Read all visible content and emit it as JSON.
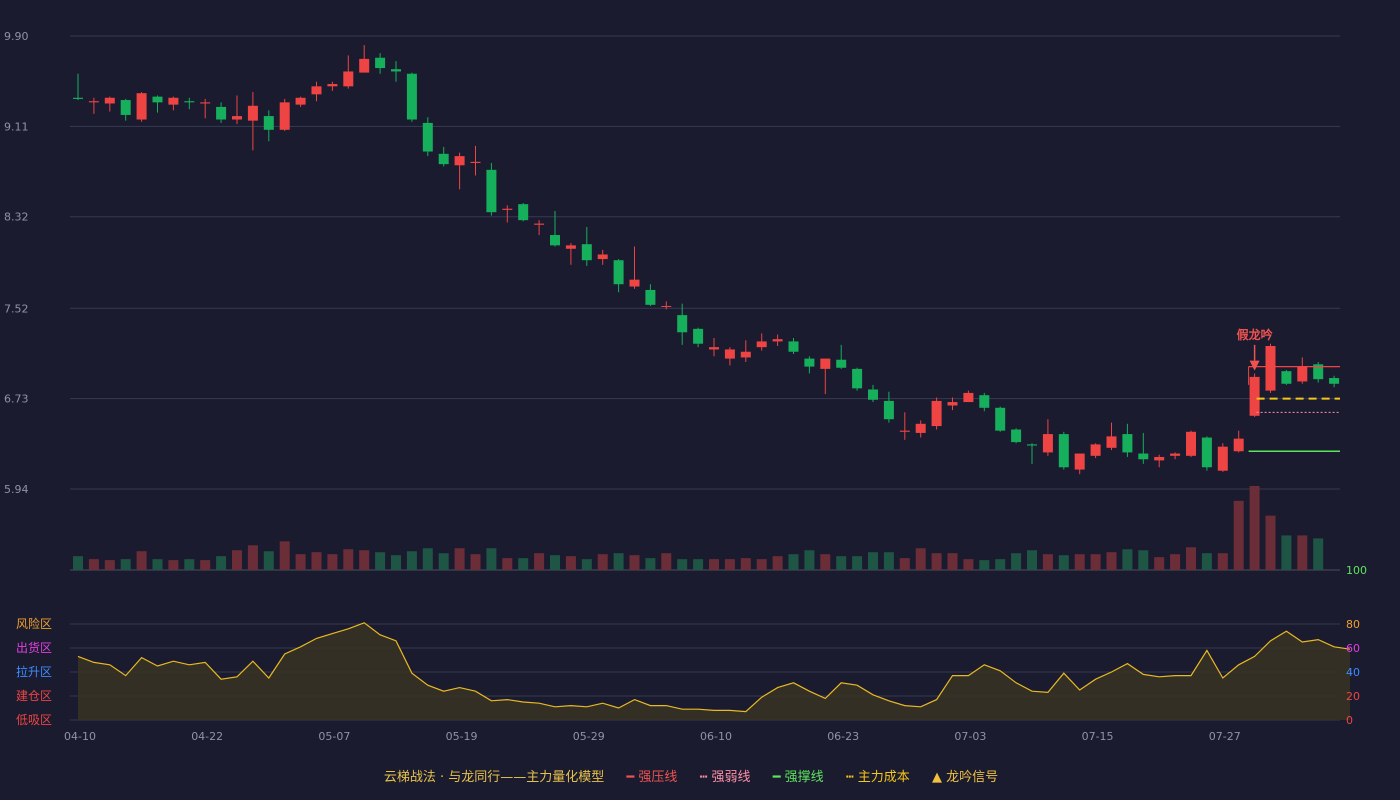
{
  "chart_data": [
    {
      "type": "candlestick",
      "title": "",
      "y_ticks": [
        "9.90",
        "9.11",
        "8.32",
        "7.52",
        "6.73",
        "5.94"
      ],
      "ylim": [
        5.94,
        9.9
      ],
      "x_ticks": [
        "04-10",
        "04-22",
        "05-07",
        "05-19",
        "05-29",
        "06-10",
        "06-23",
        "07-03",
        "07-15",
        "07-27"
      ],
      "x_tick_index": [
        0,
        8,
        16,
        24,
        32,
        40,
        48,
        56,
        64,
        72
      ],
      "candles": [
        [
          9.36,
          9.35,
          9.57,
          9.34
        ],
        [
          9.32,
          9.33,
          9.36,
          9.22
        ],
        [
          9.31,
          9.36,
          9.37,
          9.24
        ],
        [
          9.34,
          9.21,
          9.35,
          9.16
        ],
        [
          9.17,
          9.4,
          9.41,
          9.15
        ],
        [
          9.37,
          9.32,
          9.38,
          9.23
        ],
        [
          9.3,
          9.36,
          9.37,
          9.25
        ],
        [
          9.33,
          9.32,
          9.36,
          9.26
        ],
        [
          9.31,
          9.32,
          9.35,
          9.18
        ],
        [
          9.28,
          9.17,
          9.32,
          9.14
        ],
        [
          9.17,
          9.2,
          9.38,
          9.13
        ],
        [
          9.16,
          9.29,
          9.41,
          8.9
        ],
        [
          9.2,
          9.08,
          9.25,
          8.98
        ],
        [
          9.08,
          9.32,
          9.35,
          9.07
        ],
        [
          9.3,
          9.36,
          9.37,
          9.28
        ],
        [
          9.39,
          9.46,
          9.5,
          9.33
        ],
        [
          9.46,
          9.48,
          9.5,
          9.42
        ],
        [
          9.46,
          9.59,
          9.73,
          9.44
        ],
        [
          9.58,
          9.7,
          9.82,
          9.58
        ],
        [
          9.71,
          9.62,
          9.75,
          9.57
        ],
        [
          9.61,
          9.59,
          9.68,
          9.5
        ],
        [
          9.57,
          9.17,
          9.58,
          9.15
        ],
        [
          9.14,
          8.89,
          9.19,
          8.85
        ],
        [
          8.87,
          8.78,
          8.93,
          8.76
        ],
        [
          8.77,
          8.85,
          8.88,
          8.56
        ],
        [
          8.79,
          8.8,
          8.94,
          8.68
        ],
        [
          8.73,
          8.36,
          8.79,
          8.33
        ],
        [
          8.38,
          8.39,
          8.42,
          8.27
        ],
        [
          8.43,
          8.29,
          8.44,
          8.28
        ],
        [
          8.25,
          8.26,
          8.29,
          8.16
        ],
        [
          8.16,
          8.07,
          8.37,
          8.06
        ],
        [
          8.04,
          8.07,
          8.09,
          7.9
        ],
        [
          8.08,
          7.94,
          8.23,
          7.89
        ],
        [
          7.95,
          7.99,
          8.03,
          7.9
        ],
        [
          7.94,
          7.73,
          7.95,
          7.66
        ],
        [
          7.71,
          7.77,
          8.06,
          7.69
        ],
        [
          7.68,
          7.55,
          7.73,
          7.54
        ],
        [
          7.54,
          7.54,
          7.58,
          7.51
        ],
        [
          7.46,
          7.31,
          7.56,
          7.2
        ],
        [
          7.34,
          7.21,
          7.35,
          7.18
        ],
        [
          7.16,
          7.18,
          7.26,
          7.1
        ],
        [
          7.08,
          7.16,
          7.18,
          7.02
        ],
        [
          7.09,
          7.14,
          7.24,
          7.05
        ],
        [
          7.18,
          7.23,
          7.3,
          7.15
        ],
        [
          7.23,
          7.25,
          7.29,
          7.19
        ],
        [
          7.23,
          7.14,
          7.26,
          7.12
        ],
        [
          7.08,
          7.01,
          7.1,
          6.95
        ],
        [
          6.99,
          7.08,
          7.08,
          6.77
        ],
        [
          7.07,
          7.0,
          7.2,
          6.99
        ],
        [
          6.99,
          6.82,
          7.0,
          6.8
        ],
        [
          6.81,
          6.72,
          6.85,
          6.7
        ],
        [
          6.71,
          6.55,
          6.79,
          6.52
        ],
        [
          6.44,
          6.45,
          6.61,
          6.37
        ],
        [
          6.43,
          6.51,
          6.54,
          6.39
        ],
        [
          6.49,
          6.71,
          6.74,
          6.46
        ],
        [
          6.67,
          6.7,
          6.74,
          6.63
        ],
        [
          6.7,
          6.78,
          6.8,
          6.7
        ],
        [
          6.76,
          6.65,
          6.78,
          6.62
        ],
        [
          6.65,
          6.45,
          6.66,
          6.44
        ],
        [
          6.46,
          6.35,
          6.47,
          6.34
        ],
        [
          6.33,
          6.32,
          6.34,
          6.16
        ],
        [
          6.26,
          6.42,
          6.55,
          6.23
        ],
        [
          6.42,
          6.13,
          6.44,
          6.11
        ],
        [
          6.11,
          6.25,
          6.25,
          6.07
        ],
        [
          6.23,
          6.33,
          6.34,
          6.21
        ],
        [
          6.3,
          6.4,
          6.52,
          6.28
        ],
        [
          6.42,
          6.26,
          6.51,
          6.22
        ],
        [
          6.25,
          6.2,
          6.43,
          6.16
        ],
        [
          6.19,
          6.22,
          6.24,
          6.13
        ],
        [
          6.23,
          6.25,
          6.26,
          6.2
        ],
        [
          6.23,
          6.44,
          6.45,
          6.22
        ],
        [
          6.39,
          6.13,
          6.4,
          6.1
        ],
        [
          6.1,
          6.31,
          6.34,
          6.09
        ],
        [
          6.27,
          6.38,
          6.45,
          6.26
        ],
        [
          6.58,
          6.92,
          6.95,
          6.57
        ],
        [
          6.8,
          7.19,
          7.21,
          6.78
        ],
        [
          6.97,
          6.86,
          6.98,
          6.85
        ],
        [
          6.88,
          7.01,
          7.09,
          6.86
        ],
        [
          7.03,
          6.9,
          7.05,
          6.87
        ],
        [
          6.91,
          6.86,
          6.93,
          6.83
        ]
      ],
      "volumes": [
        14,
        11,
        10,
        11,
        19,
        11,
        10,
        11,
        10,
        14,
        20,
        25,
        19,
        29,
        16,
        18,
        16,
        21,
        20,
        18,
        15,
        19,
        22,
        17,
        22,
        16,
        22,
        12,
        12,
        17,
        15,
        14,
        11,
        16,
        17,
        15,
        12,
        17,
        11,
        11,
        11,
        11,
        12,
        11,
        14,
        16,
        20,
        16,
        14,
        14,
        18,
        18,
        12,
        22,
        17,
        17,
        11,
        10,
        11,
        17,
        20,
        16,
        15,
        16,
        16,
        18,
        21,
        20,
        13,
        16,
        23,
        17,
        17,
        70,
        85,
        55,
        35,
        35,
        32
      ]
    },
    {
      "type": "line",
      "title": "",
      "ylim": [
        0,
        100
      ],
      "y_ticks": [
        "100",
        "80",
        "60",
        "40",
        "20",
        "0"
      ],
      "zones": [
        "风险区",
        "出货区",
        "拉升区",
        "建仓区",
        "低吸区"
      ],
      "values": [
        53,
        48,
        46,
        37,
        52,
        45,
        49,
        46,
        48,
        34,
        36,
        49,
        35,
        55,
        61,
        68,
        72,
        76,
        81,
        71,
        66,
        39,
        29,
        24,
        27,
        24,
        16,
        17,
        15,
        14,
        11,
        12,
        11,
        14,
        10,
        17,
        12,
        12,
        9,
        9,
        8,
        8,
        7,
        19,
        27,
        31,
        24,
        18,
        31,
        29,
        21,
        16,
        12,
        11,
        17,
        37,
        37,
        46,
        41,
        31,
        24,
        23,
        39,
        25,
        34,
        40,
        47,
        38,
        36,
        37,
        37,
        58,
        35,
        46,
        53,
        66,
        74,
        65,
        67,
        61,
        59
      ]
    }
  ],
  "annotation": "假龙吟",
  "lines": {
    "strong_pressure": 7.01,
    "weak_line": 6.61,
    "cost_line": 6.73,
    "support_line": 6.27
  },
  "legend": {
    "main": "云梯战法 · 与龙同行——主力量化模型",
    "items": [
      {
        "symbol": "━",
        "label": "强压线"
      },
      {
        "symbol": "┅",
        "label": "强弱线"
      },
      {
        "symbol": "━",
        "label": "强撑线"
      },
      {
        "symbol": "┅",
        "label": "主力成本"
      },
      {
        "symbol": "▲",
        "label": "龙吟信号"
      }
    ]
  },
  "colors": {
    "up": "#ef4444",
    "down": "#16b05d",
    "vol_up": "#6b2e38",
    "vol_down": "#1e5544",
    "signal": "#e8b923",
    "grid": "#373a52",
    "zone_risk": "#f0a030",
    "zone_sell": "#e040e0",
    "zone_rise": "#3d8bff",
    "zone_build": "#ef4444",
    "zone_low": "#ef4444",
    "tick_100": "#5ee35e",
    "tick_80": "#f0a030",
    "tick_60": "#e040e0",
    "tick_40": "#3d8bff",
    "tick_20": "#ef4444",
    "tick_0": "#ef4444"
  }
}
